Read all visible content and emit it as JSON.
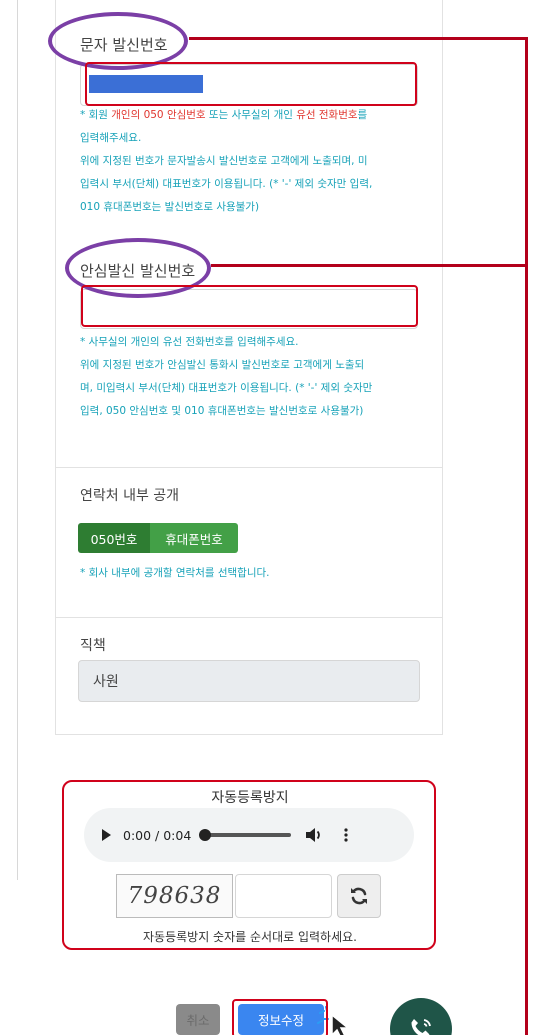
{
  "sender_number": {
    "label": "문자 발신번호",
    "help_prefix": "* 회원 ",
    "help_red": "개인의 050 안심번호",
    "help_mid": " 또는 사무실의 개인 ",
    "help_red2": "유선 전화번호",
    "help_suffix": "를",
    "help_line2": "입력해주세요.",
    "help_line3": "위에 지정된 번호가 문자발송시 발신번호로 고객에게 노출되며, 미",
    "help_line4": "입력시 부서(단체) 대표번호가 이용됩니다. (* '-' 제외 숫자만 입력,",
    "help_line5": "010 휴대폰번호는 발신번호로 사용불가)"
  },
  "safe_call_number": {
    "label": "안심발신 발신번호",
    "help_line1": "* 사무실의 개인의 유선 전화번호를 입력해주세요.",
    "help_line2": "위에 지정된 번호가 안심발신 통화시 발신번호로 고객에게 노출되",
    "help_line3": "며, 미입력시 부서(단체) 대표번호가 이용됩니다. (* '-' 제외 숫자만",
    "help_line4": "입력, 050 안심번호 및 010 휴대폰번호는 발신번호로 사용불가)"
  },
  "contact_visibility": {
    "label": "연락처 내부 공개",
    "option_050": "050번호",
    "option_mobile": "휴대폰번호",
    "help": "* 회사 내부에 공개할 연락처를 선택합니다."
  },
  "position": {
    "label": "직책",
    "value": "사원"
  },
  "captcha": {
    "title": "자동등록방지",
    "audio_time": "0:00 / 0:04",
    "image_text": "798638",
    "help": "자동등록방지 숫자를 순서대로 입력하세요."
  },
  "buttons": {
    "cancel": "취소",
    "save": "정보수정"
  },
  "colors": {
    "accent_blue": "#3a86f0",
    "help_teal": "#17a2b8",
    "annotation_purple": "#7b3fa6",
    "annotation_red": "#d0021b"
  }
}
